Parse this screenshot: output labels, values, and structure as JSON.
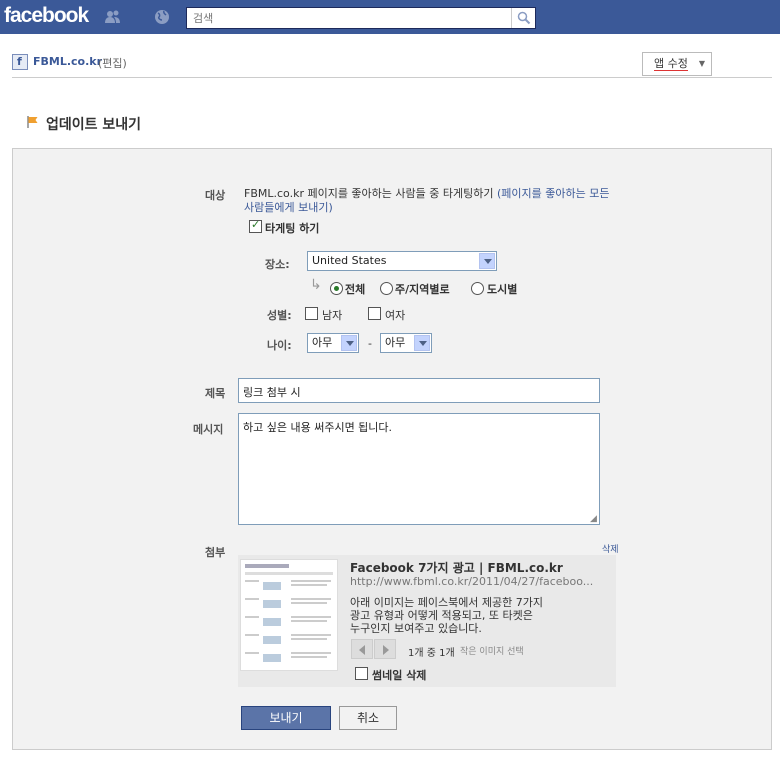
{
  "header": {
    "logo": "facebook",
    "search_placeholder": "검색"
  },
  "pagebar": {
    "page_name": "FBML.co.kr",
    "edit_label": "(편집)",
    "app_edit_label": "앱 수정"
  },
  "section": {
    "title": "업데이트 보내기"
  },
  "form": {
    "target_label": "대상",
    "target_text": "FBML.co.kr 페이지를 좋아하는 사람들 중 타게팅하기",
    "target_link": "(페이지를 좋아하는 모든 사람들에게 보내기)",
    "targeting_label": "타게팅 하기",
    "location_label": "장소:",
    "location_value": "United States",
    "radio_options": [
      "전체",
      "주/지역별로",
      "도시별"
    ],
    "gender_label": "성별:",
    "gender_male": "남자",
    "gender_female": "여자",
    "age_label": "나이:",
    "age_from": "아무",
    "age_separator": "-",
    "age_to": "아무",
    "subject_label": "제목",
    "subject_value": "링크 첨부 시",
    "message_label": "메시지",
    "message_value": "하고 싶은 내용 써주시면 됩니다.",
    "attach_label": "첨부",
    "attach_delete": "삭제"
  },
  "attachment": {
    "title": "Facebook 7가지 광고 | FBML.co.kr",
    "url": "http://www.fbml.co.kr/2011/04/27/faceboo...",
    "description_lines": [
      "아래 이미지는 페이스북에서 제공한 7가지",
      "광고 유형과 어떻게 적용되고, 또 타켓은",
      "누구인지 보여주고 있습니다."
    ],
    "pager": "1개 중 1개",
    "choose_thumb": "작은 이미지 선택",
    "no_thumb_label": "썸네일 삭제"
  },
  "buttons": {
    "send": "보내기",
    "cancel": "취소"
  },
  "colors": {
    "brand": "#3b5998",
    "panel_bg": "#f2f2f2",
    "button_primary": "#5b74a8"
  }
}
